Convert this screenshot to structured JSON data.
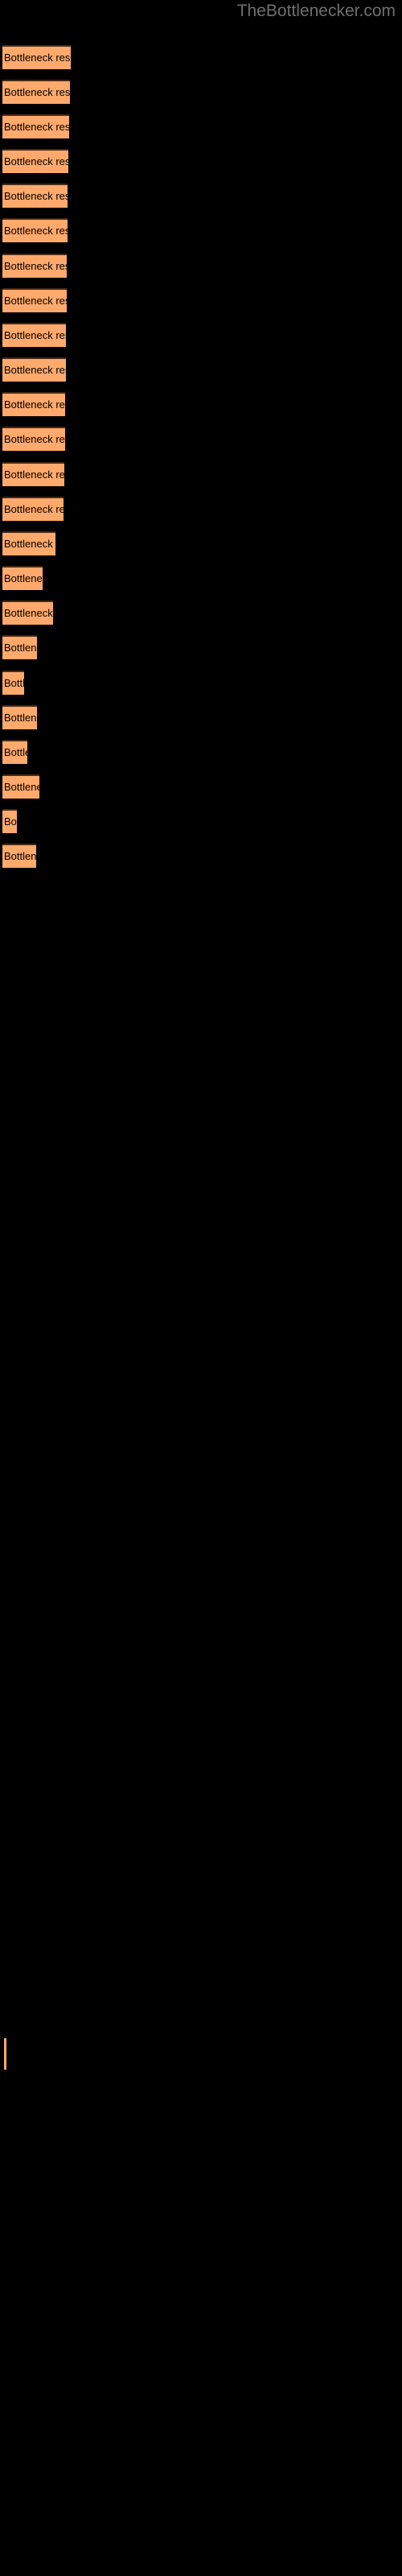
{
  "site": {
    "title": "TheBottlenecker.com",
    "title_color": "#6e6e6e"
  },
  "theme": {
    "background": "#000000",
    "bar_fill": "#ffa96c",
    "bar_border": "#4a2a14",
    "label_color": "#000000"
  },
  "legend": {
    "marker_color": "#ffa96c",
    "label": ""
  },
  "chart_data": {
    "type": "bar",
    "orientation": "horizontal",
    "title": "",
    "subtitle": "",
    "xlabel": "",
    "ylabel": "",
    "grid": false,
    "legend_position": "bottom-left",
    "axis_labels_visible": false,
    "tick_labels_visible": false,
    "bar_label_text": "Bottleneck result",
    "categories": [
      "Bottleneck result",
      "Bottleneck result",
      "Bottleneck result",
      "Bottleneck result",
      "Bottleneck result",
      "Bottleneck result",
      "Bottleneck result",
      "Bottleneck result",
      "Bottleneck result",
      "Bottleneck result",
      "Bottleneck result",
      "Bottleneck result",
      "Bottleneck result",
      "Bottleneck result",
      "Bottleneck result",
      "Bottleneck result",
      "Bottleneck result",
      "Bottleneck result",
      "Bottleneck result",
      "Bottleneck result",
      "Bottleneck result",
      "Bottleneck result",
      "Bottleneck result",
      "Bottleneck result"
    ],
    "values": [
      85,
      84,
      83,
      82,
      81,
      81,
      80,
      80,
      79,
      79,
      78,
      78,
      77,
      76,
      66,
      50,
      63,
      43,
      27,
      43,
      31,
      46,
      18,
      42
    ],
    "xlim": [
      0,
      100
    ],
    "bars": [
      {
        "index": 1,
        "label": "Bottleneck result",
        "value": 85,
        "y": 56,
        "width": 85
      },
      {
        "index": 2,
        "label": "Bottleneck result",
        "value": 84,
        "y": 99,
        "width": 84
      },
      {
        "index": 3,
        "label": "Bottleneck result",
        "value": 83,
        "y": 142,
        "width": 83
      },
      {
        "index": 4,
        "label": "Bottleneck result",
        "value": 82,
        "y": 185,
        "width": 82
      },
      {
        "index": 5,
        "label": "Bottleneck result",
        "value": 81,
        "y": 228,
        "width": 81
      },
      {
        "index": 6,
        "label": "Bottleneck result",
        "value": 81,
        "y": 271,
        "width": 81
      },
      {
        "index": 7,
        "label": "Bottleneck result",
        "value": 80,
        "y": 315,
        "width": 80
      },
      {
        "index": 8,
        "label": "Bottleneck result",
        "value": 80,
        "y": 358,
        "width": 80
      },
      {
        "index": 9,
        "label": "Bottleneck result",
        "value": 79,
        "y": 401,
        "width": 79
      },
      {
        "index": 10,
        "label": "Bottleneck result",
        "value": 79,
        "y": 444,
        "width": 79
      },
      {
        "index": 11,
        "label": "Bottleneck result",
        "value": 78,
        "y": 487,
        "width": 78
      },
      {
        "index": 12,
        "label": "Bottleneck result",
        "value": 78,
        "y": 530,
        "width": 78
      },
      {
        "index": 13,
        "label": "Bottleneck result",
        "value": 77,
        "y": 574,
        "width": 77
      },
      {
        "index": 14,
        "label": "Bottleneck result",
        "value": 76,
        "y": 617,
        "width": 76
      },
      {
        "index": 15,
        "label": "Bottleneck result",
        "value": 66,
        "y": 660,
        "width": 66
      },
      {
        "index": 16,
        "label": "Bottleneck result",
        "value": 50,
        "y": 703,
        "width": 50
      },
      {
        "index": 17,
        "label": "Bottleneck result",
        "value": 63,
        "y": 746,
        "width": 63
      },
      {
        "index": 18,
        "label": "Bottleneck result",
        "value": 43,
        "y": 789,
        "width": 43
      },
      {
        "index": 19,
        "label": "Bottleneck result",
        "value": 27,
        "y": 833,
        "width": 27
      },
      {
        "index": 20,
        "label": "Bottleneck result",
        "value": 43,
        "y": 876,
        "width": 43
      },
      {
        "index": 21,
        "label": "Bottleneck result",
        "value": 31,
        "y": 919,
        "width": 31
      },
      {
        "index": 22,
        "label": "Bottleneck result",
        "value": 46,
        "y": 962,
        "width": 46
      },
      {
        "index": 23,
        "label": "Bottleneck result",
        "value": 18,
        "y": 1005,
        "width": 18
      },
      {
        "index": 24,
        "label": "Bottleneck result",
        "value": 42,
        "y": 1048,
        "width": 42
      }
    ]
  }
}
